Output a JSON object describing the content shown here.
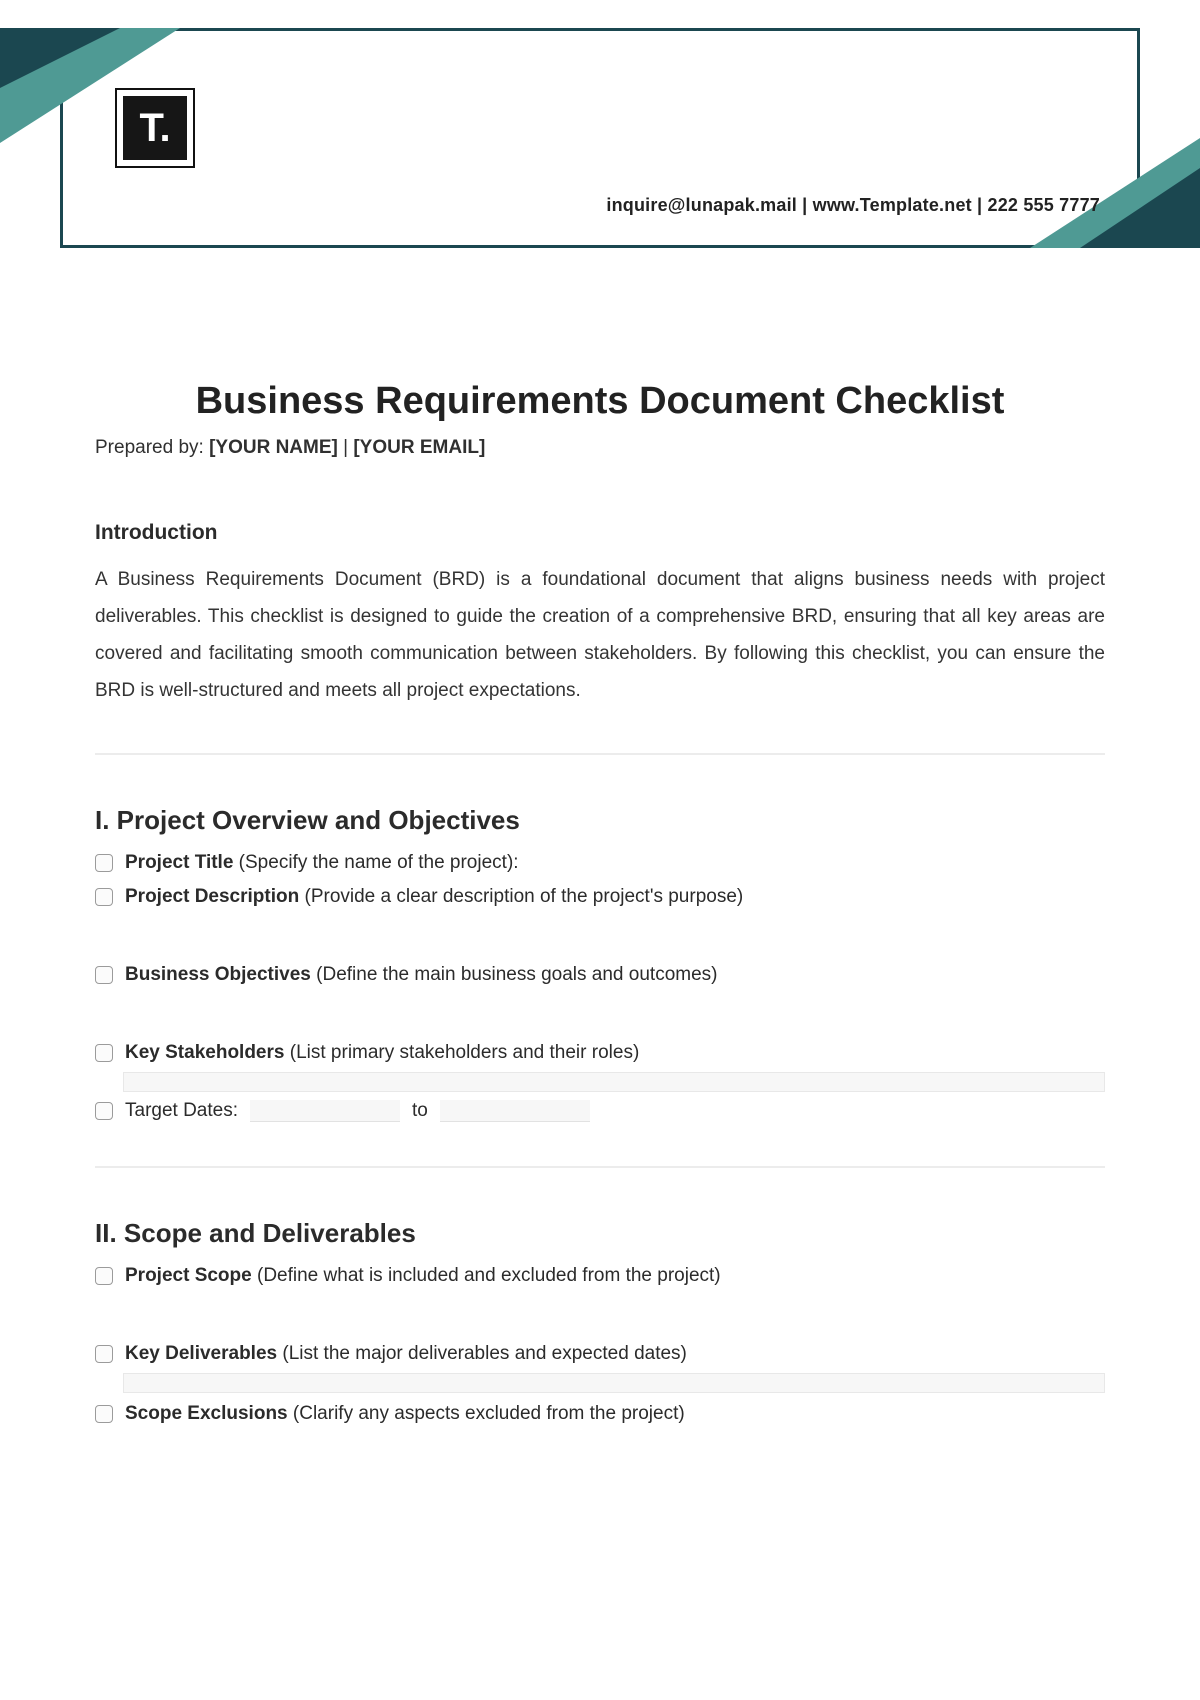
{
  "header": {
    "logo_text": "T.",
    "contact": "inquire@lunapak.mail  |  www.Template.net  |  222 555 7777"
  },
  "title": "Business Requirements Document Checklist",
  "prepared": {
    "prefix": "Prepared by: ",
    "name": "[YOUR NAME]",
    "sep": " | ",
    "email": "[YOUR EMAIL]"
  },
  "intro": {
    "heading": "Introduction",
    "body": "A Business Requirements Document (BRD) is a foundational document that aligns business needs with project deliverables. This checklist is designed to guide the creation of a comprehensive BRD, ensuring that all key areas are covered and facilitating smooth communication between stakeholders. By following this checklist, you can ensure the BRD is well-structured and meets all project expectations."
  },
  "sections": [
    {
      "heading": "I. Project Overview and Objectives",
      "items": [
        {
          "label": "Project Title",
          "desc": " (Specify the name of the project):",
          "gap": false,
          "ghost": false
        },
        {
          "label": "Project Description",
          "desc": " (Provide a clear description of the project's purpose)",
          "gap": true,
          "ghost": false
        },
        {
          "label": "Business Objectives",
          "desc": " (Define the main business goals and outcomes)",
          "gap": true,
          "ghost": false
        },
        {
          "label": "Key Stakeholders",
          "desc": " (List primary stakeholders and their roles)",
          "gap": false,
          "ghost": true
        }
      ],
      "target_dates": {
        "label": "Target Dates",
        "to": "to"
      }
    },
    {
      "heading": "II. Scope and Deliverables",
      "items": [
        {
          "label": "Project Scope",
          "desc": " (Define what is included and excluded from the project)",
          "gap": true,
          "ghost": false
        },
        {
          "label": "Key Deliverables",
          "desc": " (List the major deliverables and expected dates)",
          "gap": false,
          "ghost": true
        },
        {
          "label": "Scope Exclusions",
          "desc": " (Clarify any aspects excluded from the project)",
          "gap": false,
          "ghost": false
        }
      ]
    }
  ]
}
